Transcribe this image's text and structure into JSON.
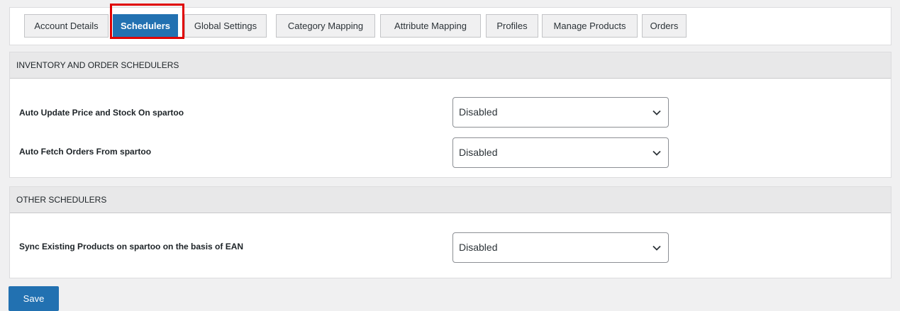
{
  "tabs": [
    {
      "label": "Account Details",
      "active": false
    },
    {
      "label": "Schedulers",
      "active": true
    },
    {
      "label": "Global Settings",
      "active": false
    },
    {
      "label": "Category Mapping",
      "active": false
    },
    {
      "label": "Attribute Mapping",
      "active": false
    },
    {
      "label": "Profiles",
      "active": false
    },
    {
      "label": "Manage Products",
      "active": false
    },
    {
      "label": "Orders",
      "active": false
    }
  ],
  "sections": [
    {
      "title": "INVENTORY AND ORDER SCHEDULERS",
      "rows": [
        {
          "label": "Auto Update Price and Stock On spartoo",
          "value": "Disabled"
        },
        {
          "label": "Auto Fetch Orders From spartoo",
          "value": "Disabled"
        }
      ]
    },
    {
      "title": "OTHER SCHEDULERS",
      "rows": [
        {
          "label": "Sync Existing Products on spartoo on the basis of EAN",
          "value": "Disabled"
        }
      ]
    }
  ],
  "save_label": "Save",
  "colors": {
    "accent": "#2271b1",
    "highlight": "#e00000"
  },
  "icons": {
    "select_arrow": "chevron-down-icon"
  }
}
